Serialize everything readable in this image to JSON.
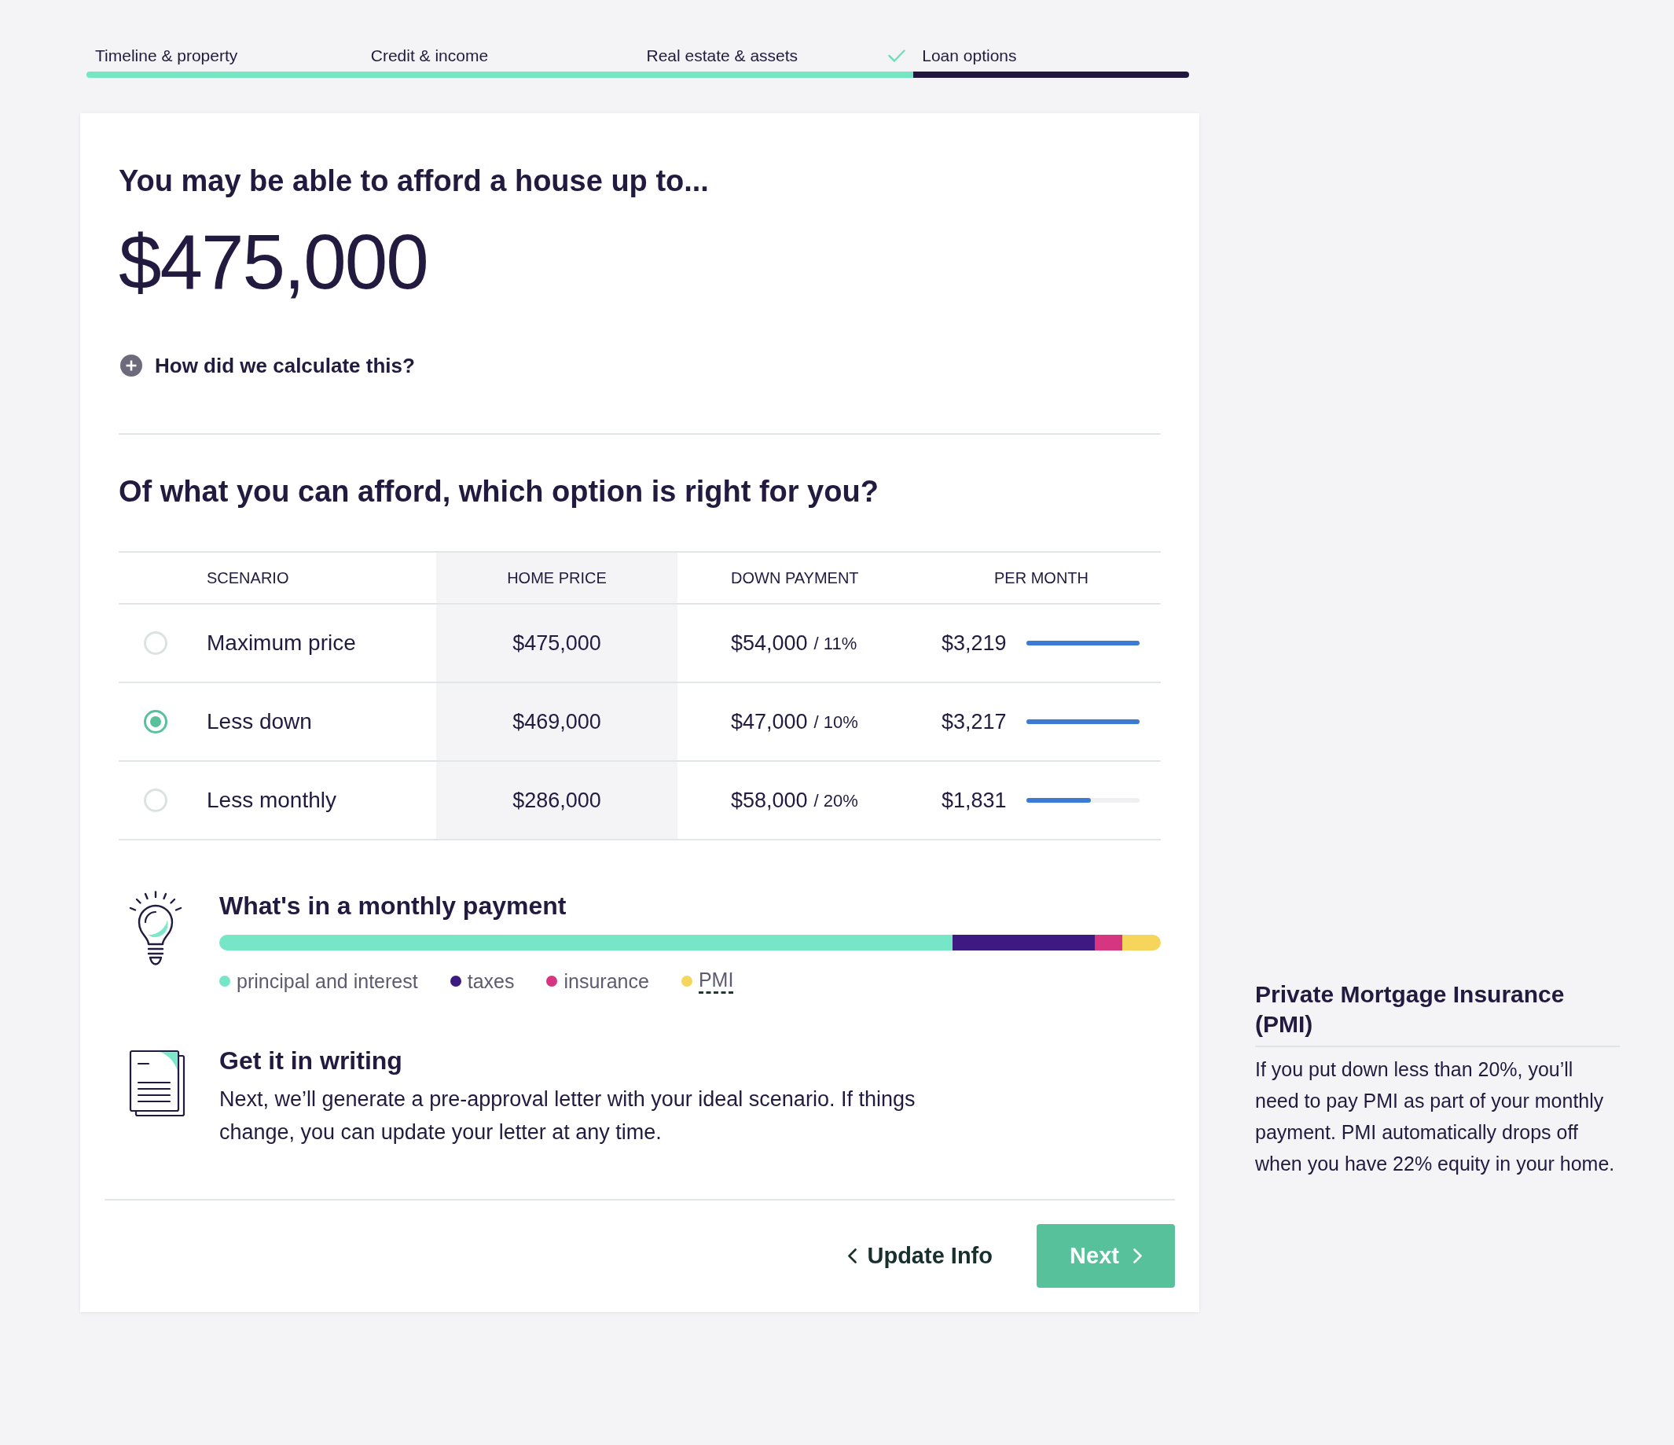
{
  "progress": {
    "steps": [
      {
        "label": "Timeline & property",
        "selected": false,
        "checked": false
      },
      {
        "label": "Credit & income",
        "selected": false,
        "checked": false
      },
      {
        "label": "Real estate & assets",
        "selected": false,
        "checked": true
      },
      {
        "label": "Loan options",
        "selected": true,
        "checked": false
      }
    ]
  },
  "affordability": {
    "heading": "You may be able to afford a house up to...",
    "amount": "$475,000",
    "calculation_toggle": {
      "label": "How did we calculate this?",
      "expanded": false
    }
  },
  "options": {
    "heading": "Of what you can afford, which option is right for you?",
    "columns": [
      "SCENARIO",
      "HOME PRICE",
      "DOWN PAYMENT",
      "PER MONTH"
    ],
    "rows": [
      {
        "selected": false,
        "scenario": "Maximum price",
        "home_price": "$475,000",
        "down_payment": "$54,000",
        "down_share": "/ 11%",
        "per_month": "$3,219",
        "level": 1
      },
      {
        "selected": true,
        "scenario": "Less down",
        "home_price": "$469,000",
        "down_payment": "$47,000",
        "down_share": "/ 10%",
        "per_month": "$3,217",
        "level": 1
      },
      {
        "selected": false,
        "scenario": "Less monthly",
        "home_price": "$286,000",
        "down_payment": "$58,000",
        "down_share": "/ 20%",
        "per_month": "$1,831",
        "level": 0.57
      }
    ]
  },
  "payment_breakdown": {
    "heading": "What's in a monthly payment",
    "items": [
      {
        "label": "principal and interest",
        "color": "#76e6c6",
        "definition": false
      },
      {
        "label": "taxes",
        "color": "#3d1a82",
        "definition": false
      },
      {
        "label": "insurance",
        "color": "#d5367f",
        "definition": false
      },
      {
        "label": "PMI",
        "color": "#f6d55c",
        "definition": true
      }
    ]
  },
  "writing": {
    "heading": "Get it in writing",
    "text": "Next, we’ll generate a pre-approval letter with your ideal scenario. If things change, you can update your letter at any time."
  },
  "footer": {
    "back_button": "Update Info",
    "next_button": "Next"
  },
  "definition_panel": {
    "title": "Private Mortgage Insurance (PMI)",
    "text": "If you put down less than 20%, you’ll need to pay PMI as part of your monthly payment. PMI automatically drops off when you have 22% equity in your home."
  }
}
